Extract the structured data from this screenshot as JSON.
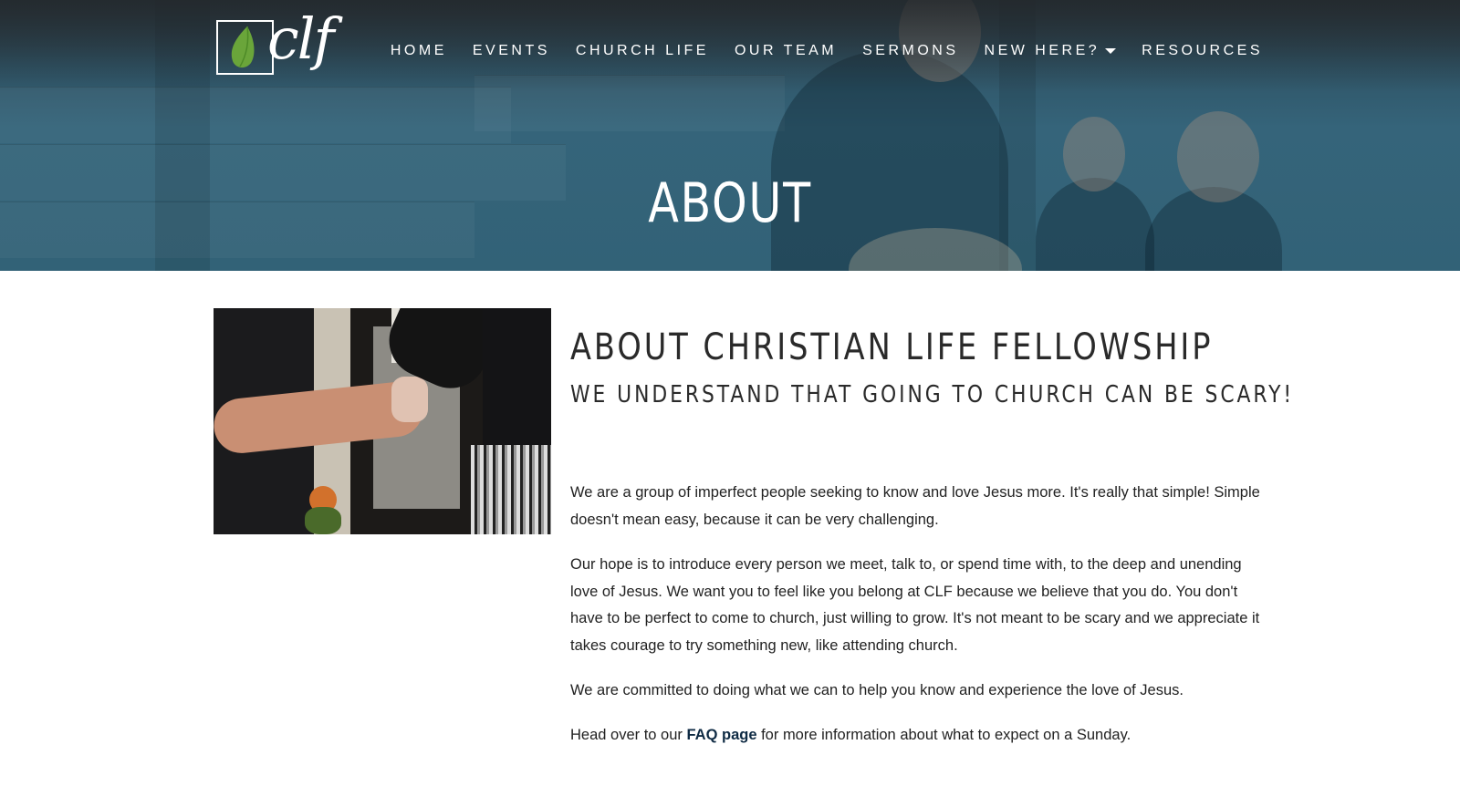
{
  "header": {
    "logo_text": "clf",
    "nav": [
      {
        "label": "HOME"
      },
      {
        "label": "EVENTS"
      },
      {
        "label": "CHURCH LIFE"
      },
      {
        "label": "OUR TEAM"
      },
      {
        "label": "SERMONS"
      },
      {
        "label": "NEW HERE?",
        "has_dropdown": true
      },
      {
        "label": "RESOURCES"
      }
    ],
    "hero_title": "ABOUT"
  },
  "main": {
    "heading": "ABOUT CHRISTIAN LIFE FELLOWSHIP",
    "subheading": "WE UNDERSTAND THAT GOING TO CHURCH CAN BE SCARY!",
    "paragraph_1": "We are a group of imperfect people seeking to know and love Jesus more.  It's really that simple! Simple doesn't mean easy, because it can be very challenging.",
    "paragraph_2": "Our hope is to introduce every person we meet, talk to, or spend time with, to the deep and unending love of Jesus.  We want you to feel like you belong at CLF because we believe that you do.  You don't have to be perfect to come to church, just willing to grow.  It's not meant to be scary and we appreciate it takes courage to try something new, like attending church.",
    "paragraph_3": "We are committed to doing what we can to help you know and experience the love of Jesus.",
    "paragraph_4_before": "Head over to our ",
    "paragraph_4_link": "FAQ page",
    "paragraph_4_after": " for more information about what to expect on a Sunday."
  },
  "icons": {
    "logo": "green-leaf-icon",
    "dropdown": "caret-down-icon"
  },
  "colors": {
    "hero_overlay": "#326277",
    "link": "#0f2b44",
    "leaf": "#6aa53a"
  }
}
